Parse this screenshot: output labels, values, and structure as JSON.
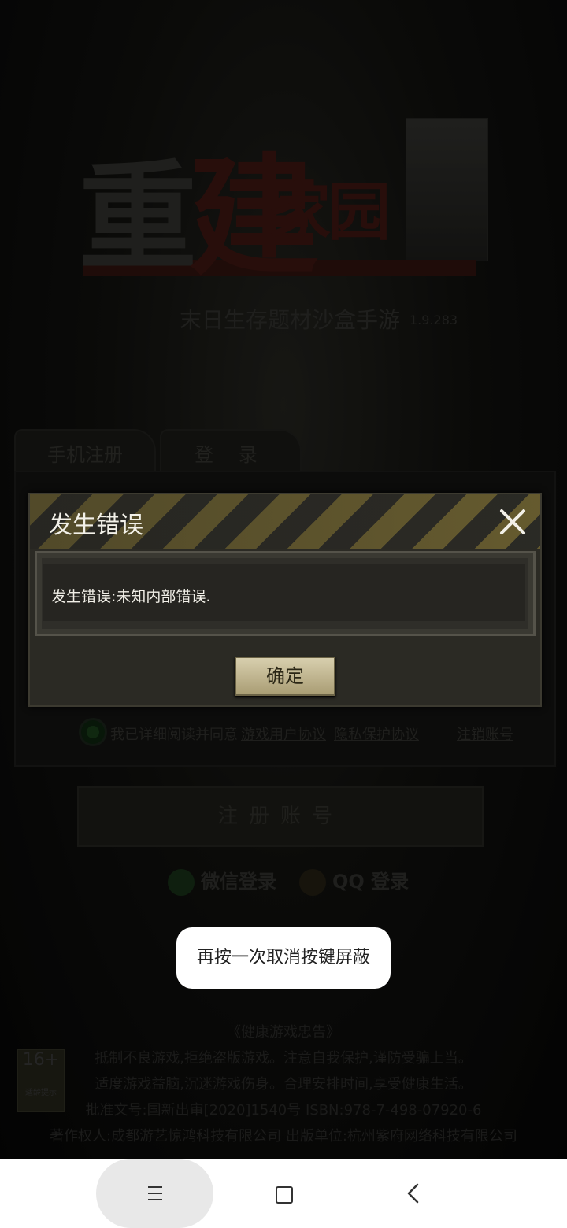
{
  "game": {
    "logo_chars": [
      "重",
      "建",
      "家园"
    ],
    "subtitle": "末日生存题材沙盒手游",
    "version": "1.9.283"
  },
  "tabs": [
    {
      "label": "手机注册"
    },
    {
      "label": "登 录"
    }
  ],
  "agreement": {
    "prefix": "我已详细阅读并同意",
    "user_agreement": "游戏用户协议",
    "privacy_agreement": "隐私保护协议",
    "cancel_account": "注销账号"
  },
  "register_button": "注册账号",
  "social_login": {
    "wechat": "微信登录",
    "qq": "QQ 登录"
  },
  "notice": {
    "title": "《健康游戏忠告》",
    "line1": "抵制不良游戏,拒绝盗版游戏。注意自我保护,谨防受骗上当。",
    "line2": "适度游戏益脑,沉迷游戏伤身。合理安排时间,享受健康生活。",
    "line3": "批准文号:国新出审[2020]1540号    ISBN:978-7-498-07920-6",
    "line4": "著作权人:成都游艺惊鸿科技有限公司 出版单位:杭州紫府网络科技有限公司",
    "age_rating": "16+",
    "age_label": "适龄提示"
  },
  "dialog": {
    "title": "发生错误",
    "message": "发生错误:未知内部错误.",
    "ok_label": "确定"
  },
  "toast": "再按一次取消按键屏蔽",
  "navbar": {
    "icons": [
      "menu-icon",
      "home-icon",
      "back-icon"
    ]
  }
}
